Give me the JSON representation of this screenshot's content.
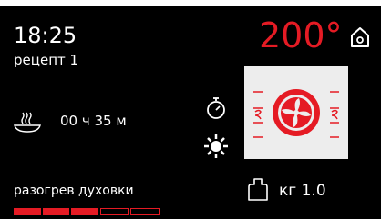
{
  "header": {
    "time": "18:25",
    "recipe": "рецепт 1",
    "temperature": "200°"
  },
  "cooking": {
    "duration": "00 ч 35 м",
    "weight": "кг 1.0",
    "status": "разогрев духовки"
  },
  "progress": {
    "segments_total": 5,
    "segments_filled": 3
  },
  "icons": {
    "home": "home-icon",
    "dish": "steaming-dish-icon",
    "timer": "timer-icon",
    "light": "oven-light-icon",
    "fan": "convection-fan-icon",
    "weight": "weight-icon"
  },
  "colors": {
    "accent": "#e51b24",
    "background": "#000000",
    "text": "#ffffff",
    "fan_panel": "#ededed"
  }
}
